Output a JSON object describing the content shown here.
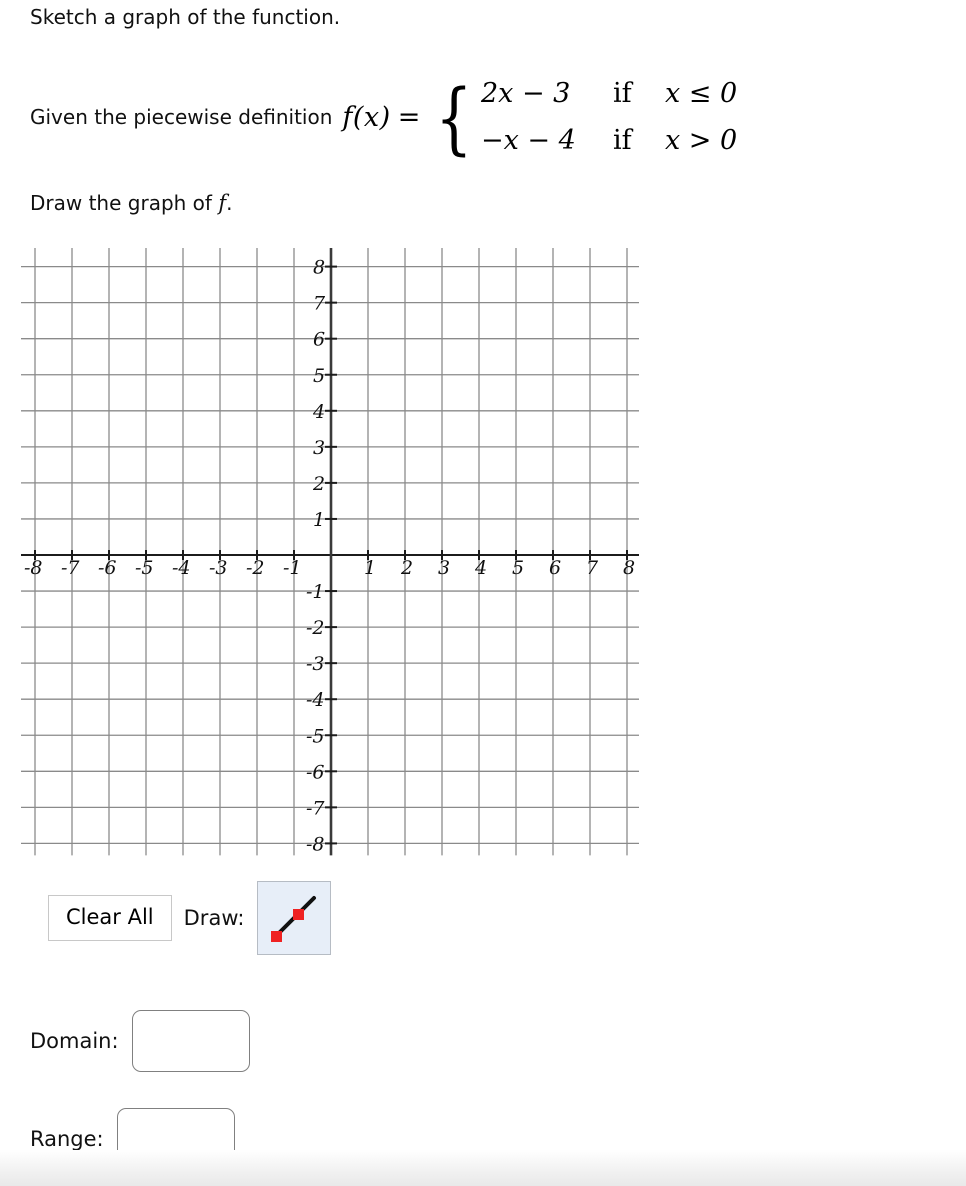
{
  "problem": {
    "instruction": "Sketch a graph of the function.",
    "given_lead": "Given the piecewise definition",
    "function_label": "f(x)",
    "equals": "=",
    "cases": [
      {
        "expression": "2x − 3",
        "if": "if",
        "condition": "x ≤ 0"
      },
      {
        "expression": "−x − 4",
        "if": "if",
        "condition": "x > 0"
      }
    ],
    "draw_instruction_prefix": "Draw the graph of ",
    "draw_instruction_symbol": "f",
    "draw_instruction_suffix": "."
  },
  "graph": {
    "x_axis_labels": [
      "-8",
      "-7",
      "-6",
      "-5",
      "-4",
      "-3",
      "-2",
      "-1",
      "1",
      "2",
      "3",
      "4",
      "5",
      "6",
      "7",
      "8"
    ],
    "y_axis_labels": [
      "8",
      "7",
      "6",
      "5",
      "4",
      "3",
      "2",
      "1",
      "-1",
      "-2",
      "-3",
      "-4",
      "-5",
      "-6",
      "-7",
      "-8"
    ],
    "xlim": [
      -8,
      8
    ],
    "ylim": [
      -8,
      8
    ],
    "grid_step": 1,
    "grid_color_vertical": "#b4b4b4",
    "grid_color_horizontal": "#8a8a8a",
    "axis_color": "#333333",
    "curve_drawn": false
  },
  "toolbar": {
    "clear_all_label": "Clear All",
    "draw_label": "Draw:",
    "tools": [
      {
        "name": "line-segment",
        "selected": true,
        "line_color": "#111111",
        "handle_color": "#ef2222",
        "background_color": "#e7eef8"
      }
    ]
  },
  "answers": [
    {
      "label": "Domain:",
      "value": "",
      "placeholder": ""
    },
    {
      "label": "Range:",
      "value": "",
      "placeholder": ""
    }
  ],
  "chart_data": {
    "type": "line",
    "title": "",
    "xlabel": "",
    "ylabel": "",
    "xlim": [
      -8,
      8
    ],
    "ylim": [
      -8,
      8
    ],
    "grid": true,
    "legend": "none",
    "xticks": [
      -8,
      -7,
      -6,
      -5,
      -4,
      -3,
      -2,
      -1,
      1,
      2,
      3,
      4,
      5,
      6,
      7,
      8
    ],
    "yticks": [
      8,
      7,
      6,
      5,
      4,
      3,
      2,
      1,
      -1,
      -2,
      -3,
      -4,
      -5,
      -6,
      -7,
      -8
    ],
    "series": [
      {
        "name": "f(x) = 2x - 3, x <= 0",
        "x": [],
        "y": [],
        "drawn": false
      },
      {
        "name": "f(x) = -x - 4, x > 0",
        "x": [],
        "y": [],
        "drawn": false
      }
    ],
    "annotations": []
  }
}
